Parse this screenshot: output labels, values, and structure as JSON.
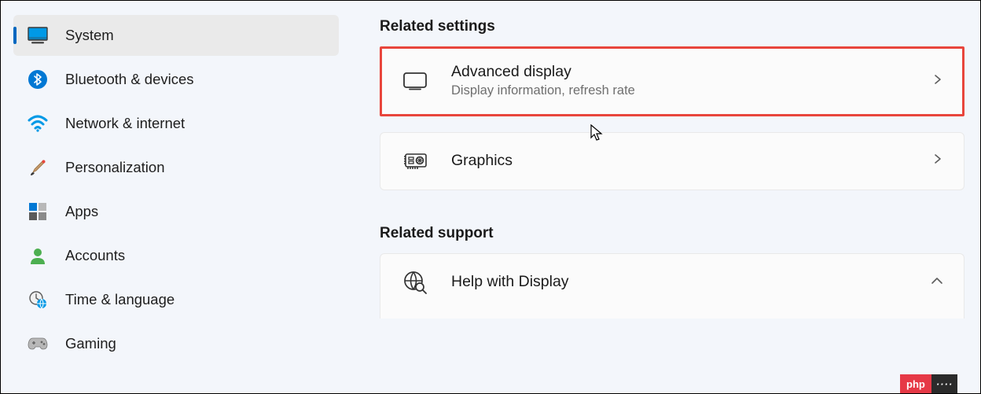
{
  "sidebar": {
    "items": [
      {
        "label": "System"
      },
      {
        "label": "Bluetooth & devices"
      },
      {
        "label": "Network & internet"
      },
      {
        "label": "Personalization"
      },
      {
        "label": "Apps"
      },
      {
        "label": "Accounts"
      },
      {
        "label": "Time & language"
      },
      {
        "label": "Gaming"
      }
    ]
  },
  "main": {
    "related_settings_title": "Related settings",
    "advanced_display": {
      "title": "Advanced display",
      "subtitle": "Display information, refresh rate"
    },
    "graphics": {
      "title": "Graphics"
    },
    "related_support_title": "Related support",
    "help_display": {
      "title": "Help with Display"
    }
  },
  "watermark": {
    "left": "php",
    "right": "····"
  }
}
